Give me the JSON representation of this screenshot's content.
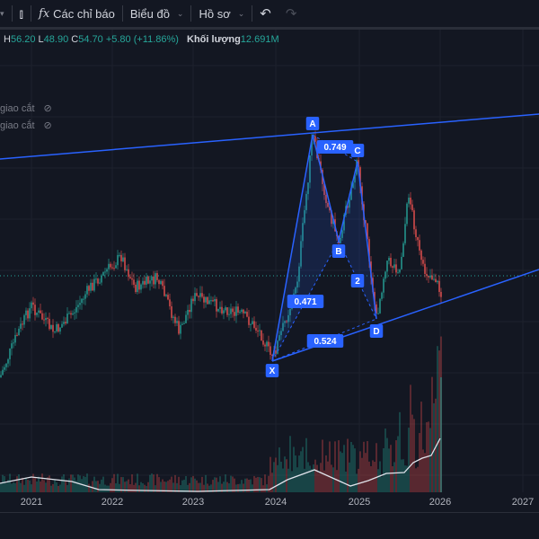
{
  "toolbar": {
    "chart_type_icon": "candlestick-icon",
    "indicators_label": "Các chỉ báo",
    "chart_label": "Biểu đồ",
    "profile_label": "Hồ sơ",
    "undo_icon": "undo-icon",
    "redo_icon": "redo-icon"
  },
  "legend": {
    "h_label": "H",
    "h_value": "56.20",
    "l_label": "L",
    "l_value": "48.90",
    "c_label": "C",
    "c_value": "54.70",
    "change": "+5.80 (+11.86%)",
    "volume_label": "Khối lượng",
    "volume_value": "12.691M"
  },
  "indicators": [
    {
      "label": "giao cắt"
    },
    {
      "label": "giao cắt"
    }
  ],
  "pattern": {
    "points": [
      "X",
      "A",
      "B",
      "C",
      "D"
    ],
    "ratios": {
      "xb": "0.471",
      "ac": "0.749",
      "bd": "2",
      "xd": "0.524"
    }
  },
  "time_axis": [
    "2021",
    "2022",
    "2023",
    "2024",
    "2025",
    "2026",
    "2027"
  ],
  "colors": {
    "up": "#26a69a",
    "down": "#ef5350",
    "pattern": "#2962ff",
    "background": "#131722"
  }
}
